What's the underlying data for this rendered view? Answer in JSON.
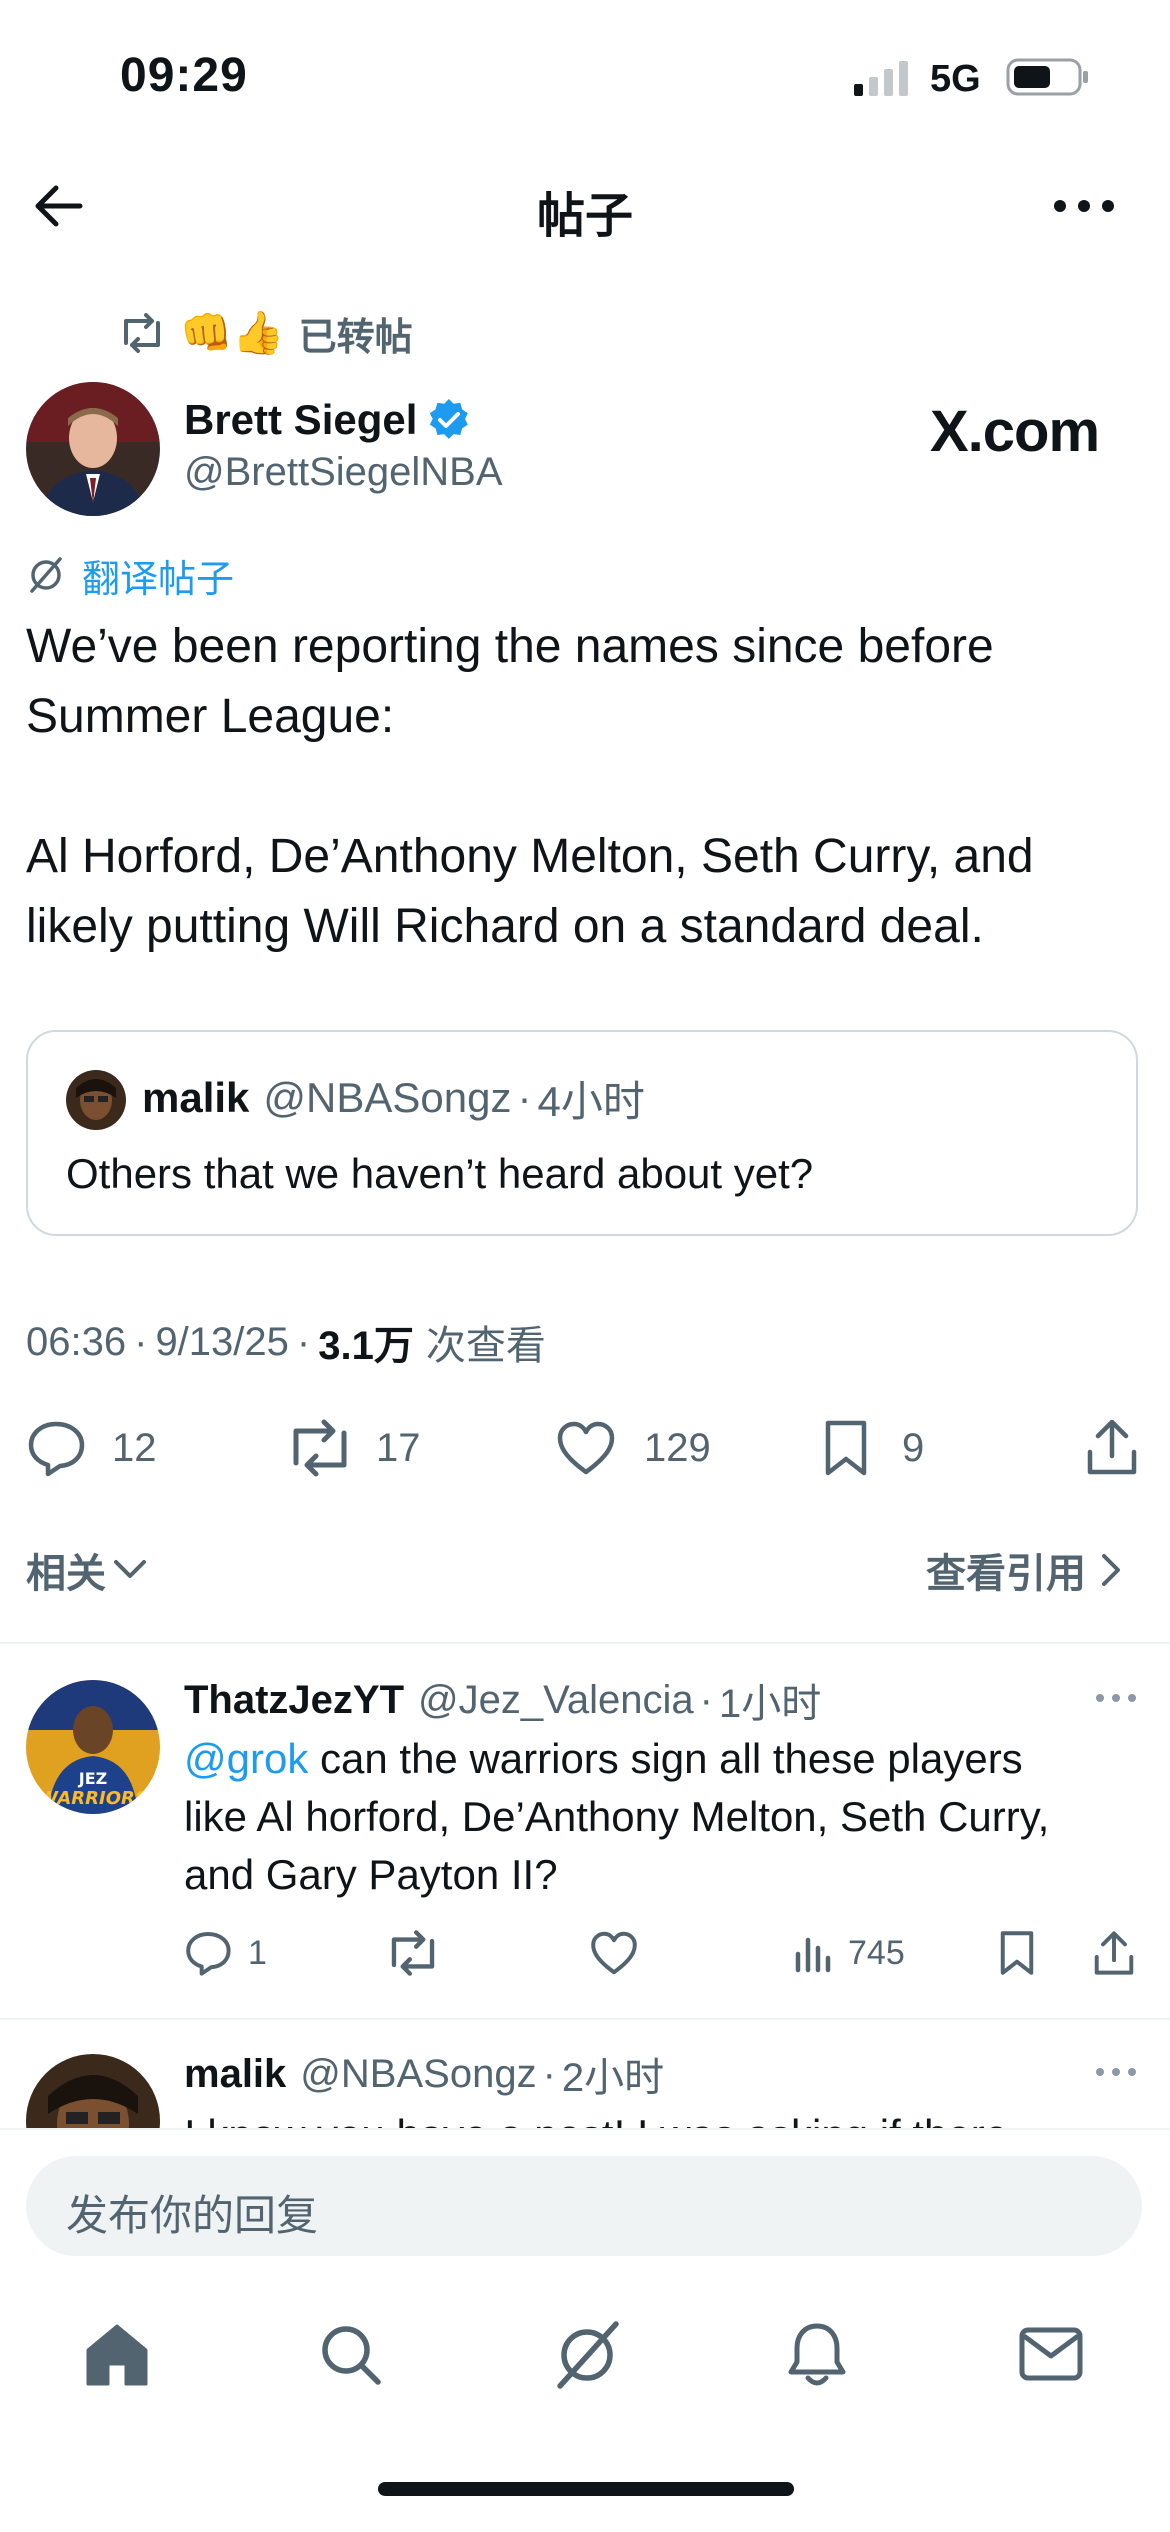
{
  "status_bar": {
    "time": "09:29",
    "network": "5G"
  },
  "header": {
    "title": "帖子"
  },
  "repost_context": {
    "emojis": "👊👍",
    "label": "已转帖"
  },
  "post": {
    "author_name": "Brett Siegel",
    "handle": "@BrettSiegelNBA",
    "source_watermark": "X.com",
    "translate_label": "翻译帖子",
    "text_line1": "We’ve been reporting the names since before",
    "text_line2": "Summer League:",
    "text_line3": "Al Horford, De’Anthony Melton, Seth Curry, and",
    "text_line4": "likely putting Will Richard on a standard deal.",
    "quoted": {
      "author": "malik",
      "handle": "@NBASongz",
      "time": "4小时",
      "text": "Others that we haven’t heard about yet?"
    },
    "meta": {
      "time": "06:36",
      "date": "9/13/25",
      "views_count": "3.1万",
      "views_label": "次查看"
    },
    "stats": {
      "replies": "12",
      "reposts": "17",
      "likes": "129",
      "bookmarks": "9"
    }
  },
  "related_bar": {
    "left": "相关",
    "right": "查看引用"
  },
  "replies": [
    {
      "name": "ThatzJezYT",
      "handle": "@Jez_Valencia",
      "time": "1小时",
      "mention": "@grok",
      "text_line1": "can the warriors sign all these players",
      "text_line2": "like Al horford, De’Anthony Melton, Seth Curry,",
      "text_line3": "and Gary Payton II?",
      "reply_count": "1",
      "views": "745"
    },
    {
      "name": "malik",
      "handle": "@NBASongz",
      "time": "2小时",
      "text_line1": "I know you have a post! I was asking if there"
    }
  ],
  "composer": {
    "placeholder": "发布你的回复"
  },
  "icons": [
    "back-arrow-icon",
    "more-icon",
    "repost-icon",
    "verified-icon",
    "translate-icon",
    "reply-icon",
    "like-icon",
    "bookmark-icon",
    "share-icon",
    "views-icon",
    "chevron-down-icon",
    "chevron-right-icon",
    "home-icon",
    "search-icon",
    "grok-icon",
    "notifications-icon",
    "messages-icon"
  ],
  "colors": {
    "accent": "#1d9bf0",
    "text": "#0f1419",
    "muted": "#536471",
    "divider": "#eff3f4"
  }
}
